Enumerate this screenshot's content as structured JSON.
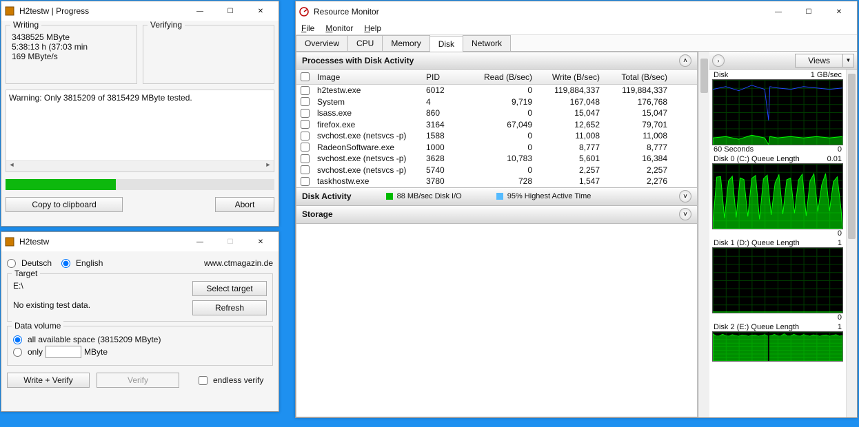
{
  "progress": {
    "title": "H2testw | Progress",
    "writing": {
      "label": "Writing",
      "mbyte": "3438525 MByte",
      "time": "5:38:13 h (37:03 min",
      "rate": "169 MByte/s"
    },
    "verifying": {
      "label": "Verifying"
    },
    "log": "Warning: Only 3815209 of 3815429 MByte tested.",
    "percent": 41,
    "copy_btn": "Copy to clipboard",
    "abort_btn": "Abort"
  },
  "h2": {
    "title": "H2testw",
    "lang_de": "Deutsch",
    "lang_en": "English",
    "url": "www.ctmagazin.de",
    "target_label": "Target",
    "target_path": "E:\\",
    "no_data": "No existing test data.",
    "select_btn": "Select target",
    "refresh_btn": "Refresh",
    "dv_label": "Data volume",
    "dv_all": "all available space (3815209 MByte)",
    "dv_only": "only",
    "dv_unit": "MByte",
    "write_verify_btn": "Write + Verify",
    "verify_btn": "Verify",
    "endless": "endless verify"
  },
  "res": {
    "title": "Resource Monitor",
    "menu": [
      "File",
      "Monitor",
      "Help"
    ],
    "tabs": [
      "Overview",
      "CPU",
      "Memory",
      "Disk",
      "Network"
    ],
    "active_tab": "Disk",
    "panel_proc": "Processes with Disk Activity",
    "panel_act": "Disk Activity",
    "panel_storage": "Storage",
    "act_io_label": "88 MB/sec Disk I/O",
    "act_hi_label": "95% Highest Active Time",
    "columns": {
      "image": "Image",
      "pid": "PID",
      "read": "Read (B/sec)",
      "write": "Write (B/sec)",
      "total": "Total (B/sec)"
    },
    "rows": [
      {
        "image": "h2testw.exe",
        "pid": "6012",
        "read": "0",
        "write": "119,884,337",
        "total": "119,884,337"
      },
      {
        "image": "System",
        "pid": "4",
        "read": "9,719",
        "write": "167,048",
        "total": "176,768"
      },
      {
        "image": "lsass.exe",
        "pid": "860",
        "read": "0",
        "write": "15,047",
        "total": "15,047"
      },
      {
        "image": "firefox.exe",
        "pid": "3164",
        "read": "67,049",
        "write": "12,652",
        "total": "79,701"
      },
      {
        "image": "svchost.exe (netsvcs -p)",
        "pid": "1588",
        "read": "0",
        "write": "11,008",
        "total": "11,008"
      },
      {
        "image": "RadeonSoftware.exe",
        "pid": "1000",
        "read": "0",
        "write": "8,777",
        "total": "8,777"
      },
      {
        "image": "svchost.exe (netsvcs -p)",
        "pid": "3628",
        "read": "10,783",
        "write": "5,601",
        "total": "16,384"
      },
      {
        "image": "svchost.exe (netsvcs -p)",
        "pid": "5740",
        "read": "0",
        "write": "2,257",
        "total": "2,257"
      },
      {
        "image": "taskhostw.exe",
        "pid": "3780",
        "read": "728",
        "write": "1,547",
        "total": "2,276"
      }
    ],
    "charts": [
      {
        "left": "Disk",
        "right": "1 GB/sec",
        "foot_left": "60 Seconds",
        "foot_right": "0",
        "style": "disk"
      },
      {
        "left": "Disk 0 (C:) Queue Length",
        "right": "0.01",
        "foot_left": "",
        "foot_right": "0",
        "style": "queue-busy"
      },
      {
        "left": "Disk 1 (D:) Queue Length",
        "right": "1",
        "foot_left": "",
        "foot_right": "0",
        "style": "flat"
      },
      {
        "left": "Disk 2 (E:) Queue Length",
        "right": "1",
        "foot_left": "",
        "foot_right": "",
        "style": "high"
      }
    ],
    "views_label": "Views"
  }
}
